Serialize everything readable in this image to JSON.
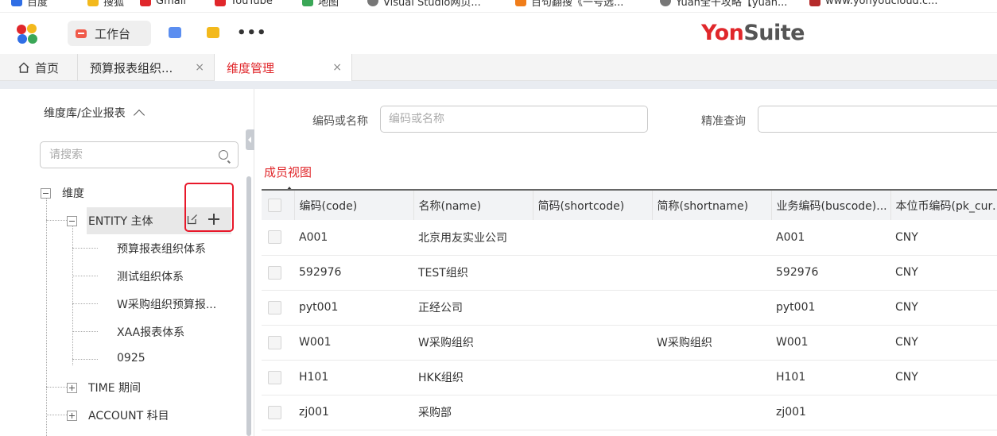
{
  "bookmarks": [
    {
      "label": "百度",
      "color": "#2f6ee5"
    },
    {
      "label": "搜狐",
      "color": "#f3b91c"
    },
    {
      "label": "Gmail",
      "color": "#e0272b"
    },
    {
      "label": "YouTube",
      "color": "#e0272b"
    },
    {
      "label": "地图",
      "color": "#3aa757"
    },
    {
      "label": "Visual Studio网页...",
      "color": "#777"
    },
    {
      "label": "百句翻搜《一号选...",
      "color": "#f07d1a"
    },
    {
      "label": "Yuan全干攻略【yuan...",
      "color": "#777"
    },
    {
      "label": "www.yonyoucloud.c...",
      "color": "#b52b2b"
    }
  ],
  "header": {
    "workbench_label": "工作台",
    "brand_yon": "Yon",
    "brand_suite": "Suite",
    "more_label": "•••"
  },
  "tabs": [
    {
      "label": "首页"
    },
    {
      "label": "预算报表组织...",
      "close": "×"
    },
    {
      "label": "维度管理",
      "close": "×"
    }
  ],
  "colors": {
    "accent": "#e0272b",
    "highlight_box": "#e8182a"
  },
  "sidebar": {
    "library_title": "维度库/企业报表",
    "search_placeholder": "请搜索",
    "tree": {
      "root": "维度",
      "entity": "ENTITY 主体",
      "entity_children": [
        "预算报表组织体系",
        "测试组织体系",
        "W采购组织预算报...",
        "XAA报表体系",
        "0925"
      ],
      "time": "TIME 期间",
      "account": "ACCOUNT 科目"
    }
  },
  "filters": {
    "code_label": "编码或名称",
    "code_placeholder": "编码或名称",
    "exact_label": "精准查询",
    "exact_placeholder": ""
  },
  "view_label": "成员视图",
  "table": {
    "columns": [
      "编码(code)",
      "名称(name)",
      "简码(shortcode)",
      "简称(shortname)",
      "业务编码(buscode)...",
      "本位币编码(pk_curr..."
    ],
    "rows": [
      [
        "A001",
        "北京用友实业公司",
        "",
        "",
        "A001",
        "CNY"
      ],
      [
        "592976",
        "TEST组织",
        "",
        "",
        "592976",
        "CNY"
      ],
      [
        "pyt001",
        "正经公司",
        "",
        "",
        "pyt001",
        "CNY"
      ],
      [
        "W001",
        "W采购组织",
        "",
        "W采购组织",
        "W001",
        "CNY"
      ],
      [
        "H101",
        "HKK组织",
        "",
        "",
        "H101",
        "CNY"
      ],
      [
        "zj001",
        "采购部",
        "",
        "",
        "zj001",
        ""
      ]
    ]
  }
}
